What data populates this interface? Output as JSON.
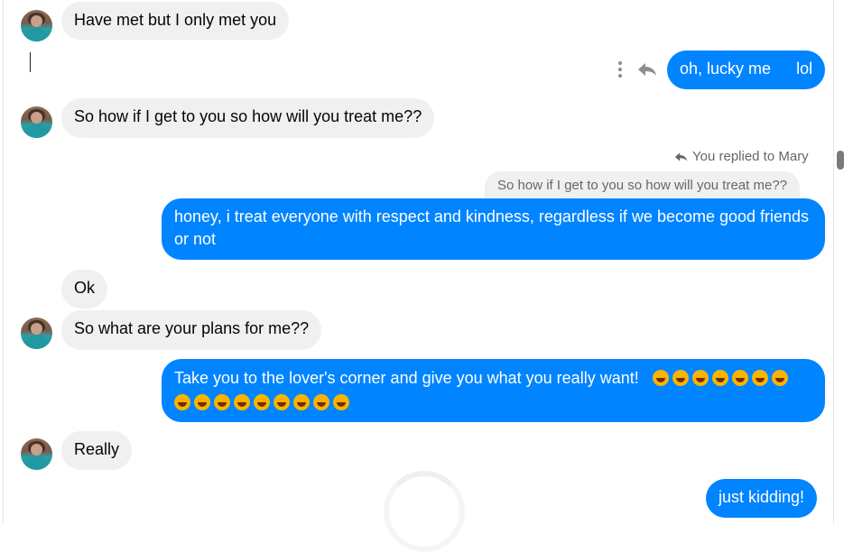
{
  "messages": {
    "m1": "Have met but I only met you",
    "m2": "oh, lucky me",
    "m2b": "lol",
    "m3": "So how if I get to you so how will you treat me??",
    "reply_meta": "You replied to Mary",
    "quoted": "So how if I get to you so how will you treat me??",
    "m4": "honey, i treat everyone with respect and kindness, regardless if we become good friends or not",
    "m5": "Ok",
    "m6": "So what are your plans for me??",
    "m7": "Take you to the lover's corner and give you what you really want!",
    "m8": "Really",
    "m9": "just kidding!"
  },
  "emoji_line1_count": 7,
  "emoji_line2_count": 9,
  "icons": {
    "more": "vertical-dots-icon",
    "reply": "reply-arrow-icon",
    "avatar": "user-avatar"
  },
  "colors": {
    "outgoing_bubble": "#0084ff",
    "incoming_bubble": "#f0f0f0",
    "meta_text": "#65676b"
  }
}
